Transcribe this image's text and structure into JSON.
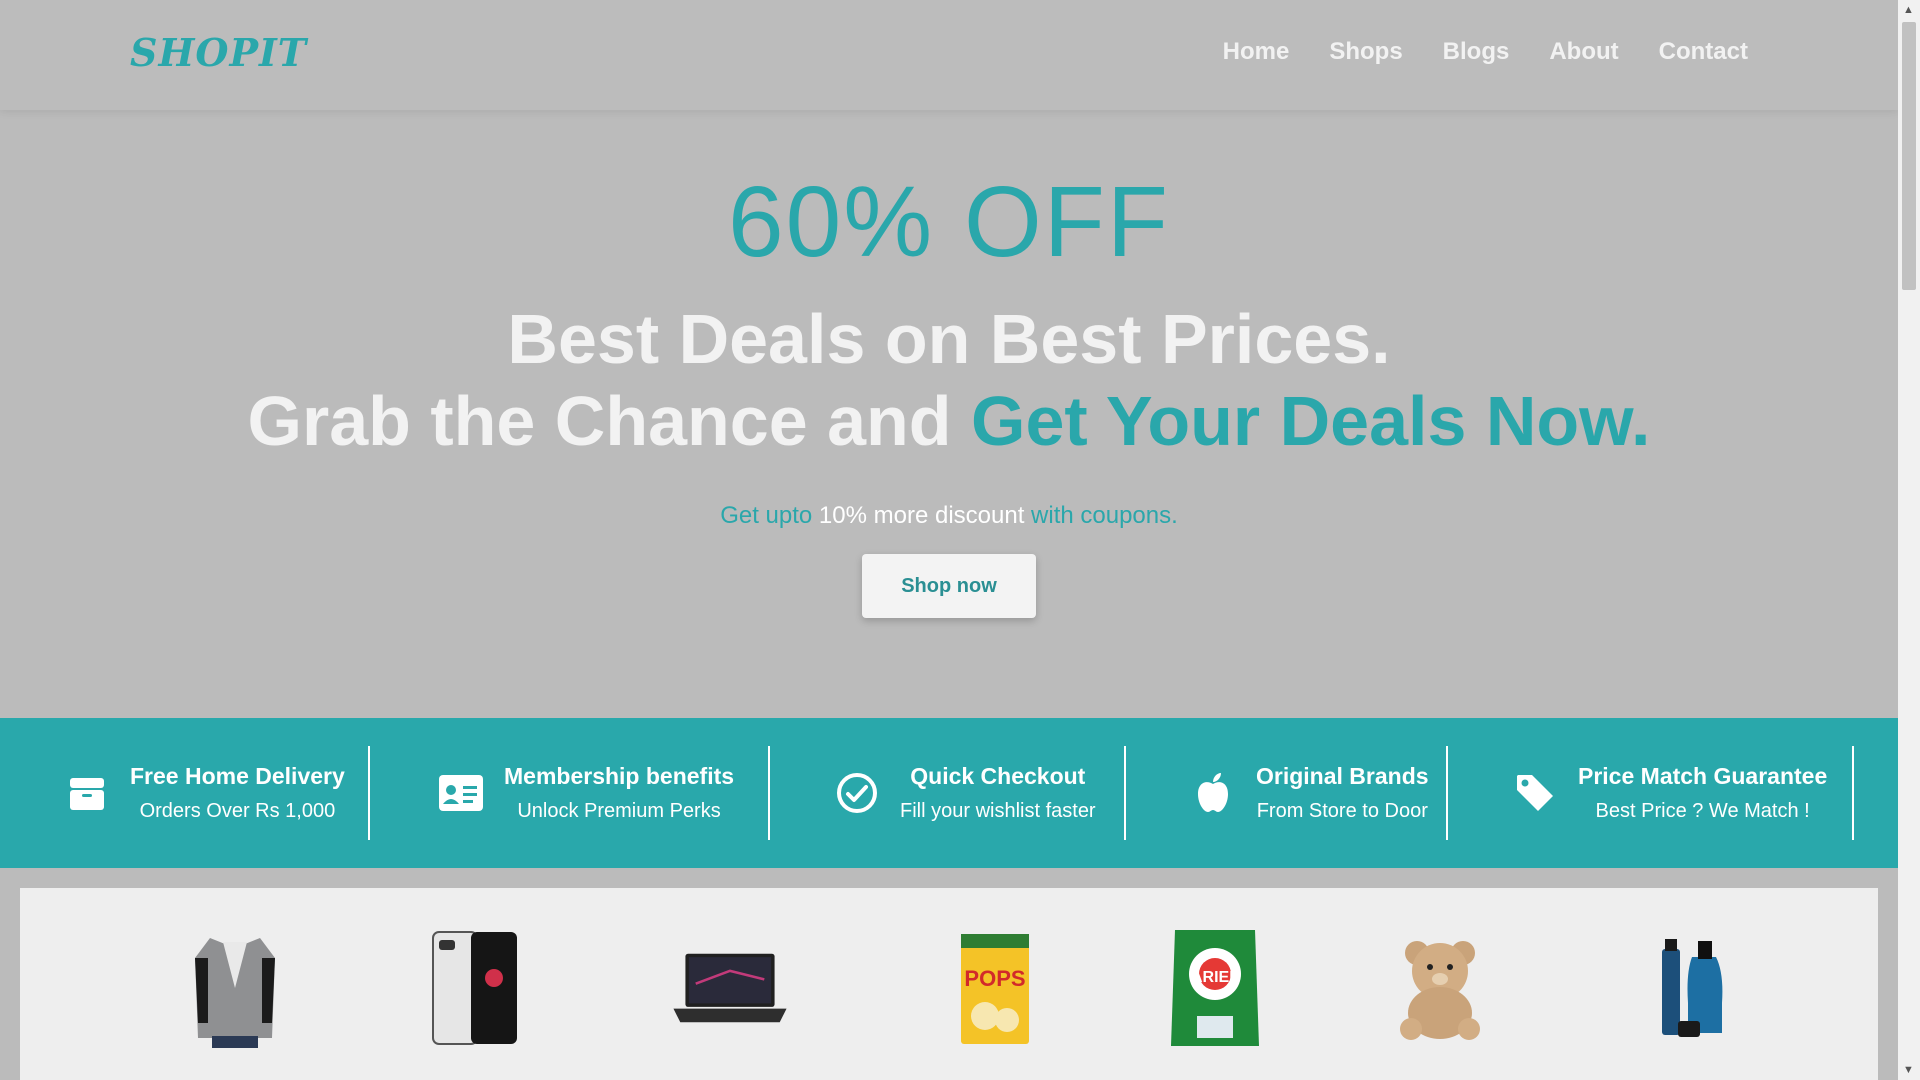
{
  "header": {
    "logo": "SHOPIT",
    "nav": [
      "Home",
      "Shops",
      "Blogs",
      "About",
      "Contact"
    ]
  },
  "hero": {
    "offer": "60% OFF",
    "headline_line1": "Best Deals on Best Prices.",
    "headline_line2_plain": "Grab the Chance and ",
    "headline_line2_accent": "Get Your Deals Now.",
    "sub_before": "Get upto ",
    "sub_highlight": "10% more discount",
    "sub_after": " with coupons.",
    "button": "Shop now"
  },
  "features": [
    {
      "icon": "box-icon",
      "title": "Free Home Delivery",
      "subtitle": "Orders Over Rs 1,000"
    },
    {
      "icon": "id-card-icon",
      "title": "Membership benefits",
      "subtitle": "Unlock Premium Perks"
    },
    {
      "icon": "check-circle-icon",
      "title": "Quick Checkout",
      "subtitle": "Fill your wishlist faster"
    },
    {
      "icon": "apple-icon",
      "title": "Original Brands",
      "subtitle": "From Store to Door"
    },
    {
      "icon": "tag-icon",
      "title": "Price Match Guarantee",
      "subtitle": "Best Price ? We Match !"
    }
  ],
  "products": [
    "blazer-image",
    "phone-image",
    "laptop-image",
    "cereal-image",
    "detergent-image",
    "teddy-bear-image",
    "perfume-image"
  ],
  "colors": {
    "accent": "#2aa7ab",
    "header_bg": "#bcbcbc",
    "band_bg": "#29a8ab"
  }
}
